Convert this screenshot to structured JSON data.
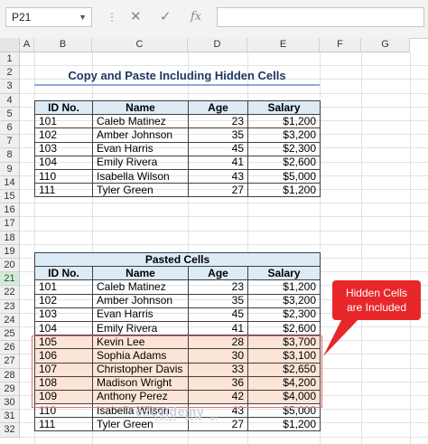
{
  "formula_bar": {
    "name_box": "P21",
    "cancel_icon": "✕",
    "enter_icon": "✓",
    "fx_icon": "fx",
    "formula": ""
  },
  "columns": [
    "A",
    "B",
    "C",
    "D",
    "E",
    "F",
    "G"
  ],
  "rows": [
    "1",
    "2",
    "3",
    "4",
    "5",
    "6",
    "7",
    "8",
    "9",
    "14",
    "15",
    "16",
    "17",
    "18",
    "19",
    "20",
    "21",
    "22",
    "23",
    "24",
    "25",
    "26",
    "27",
    "28",
    "29",
    "30",
    "31",
    "32"
  ],
  "selected_row": "21",
  "title": "Copy and Paste Including Hidden Cells",
  "table1": {
    "headers": [
      "ID No.",
      "Name",
      "Age",
      "Salary"
    ],
    "rows": [
      [
        "101",
        "Caleb Matinez",
        "23",
        "$1,200"
      ],
      [
        "102",
        "Amber Johnson",
        "35",
        "$3,200"
      ],
      [
        "103",
        "Evan Harris",
        "45",
        "$2,300"
      ],
      [
        "104",
        "Emily Rivera",
        "41",
        "$2,600"
      ],
      [
        "110",
        "Isabella Wilson",
        "43",
        "$5,000"
      ],
      [
        "111",
        "Tyler Green",
        "27",
        "$1,200"
      ]
    ]
  },
  "table2": {
    "caption": "Pasted Cells",
    "headers": [
      "ID No.",
      "Name",
      "Age",
      "Salary"
    ],
    "rows": [
      [
        "101",
        "Caleb Matinez",
        "23",
        "$1,200"
      ],
      [
        "102",
        "Amber Johnson",
        "35",
        "$3,200"
      ],
      [
        "103",
        "Evan Harris",
        "45",
        "$2,300"
      ],
      [
        "104",
        "Emily Rivera",
        "41",
        "$2,600"
      ],
      [
        "105",
        "Kevin Lee",
        "28",
        "$3,700"
      ],
      [
        "106",
        "Sophia Adams",
        "30",
        "$3,100"
      ],
      [
        "107",
        "Christopher Davis",
        "33",
        "$2,650"
      ],
      [
        "108",
        "Madison Wright",
        "36",
        "$4,200"
      ],
      [
        "109",
        "Anthony Perez",
        "42",
        "$4,000"
      ],
      [
        "110",
        "Isabella Wilson",
        "43",
        "$5,000"
      ],
      [
        "111",
        "Tyler Green",
        "27",
        "$1,200"
      ]
    ]
  },
  "callout": {
    "line1": "Hidden Cells",
    "line2": "are Included"
  },
  "watermark": {
    "brand": "exceldemy",
    "tagline": "EXCEL · DATA · BI"
  },
  "colors": {
    "header_fill": "#ddebf7",
    "highlight_fill": "#fce4d6",
    "callout": "#e8272a",
    "title": "#1f3864"
  }
}
